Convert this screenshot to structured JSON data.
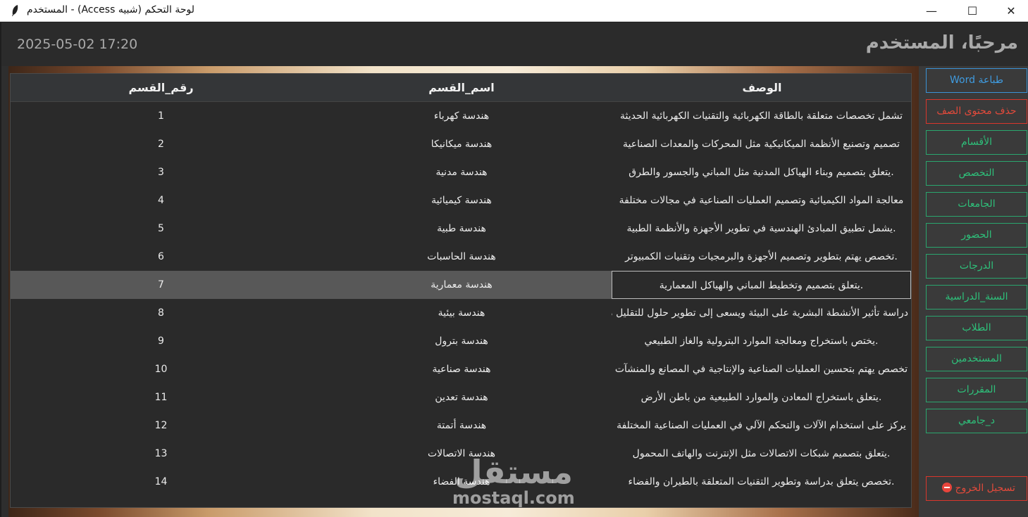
{
  "window": {
    "title": "المستخدم - (Access شبيه) لوحة التحكم",
    "min_icon": "—",
    "max_icon": "☐",
    "close_icon": "✕"
  },
  "header": {
    "welcome": "مرحبًا، المستخدم",
    "datetime": "2025-05-02 17:20"
  },
  "table": {
    "columns": {
      "description": "الوصف",
      "name": "اسم_القسم",
      "number": "رقم_القسم"
    },
    "rows": [
      {
        "number": "1",
        "name": "هندسة كهرباء",
        "description": "تشمل تخصصات متعلقة بالطاقة الكهربائية والتقنيات الكهربائية الحديثة"
      },
      {
        "number": "2",
        "name": "هندسة ميكانيكا",
        "description": "تصميم وتصنيع الأنظمة الميكانيكية مثل المحركات والمعدات الصناعية"
      },
      {
        "number": "3",
        "name": "هندسة مدنية",
        "description": ".يتعلق بتصميم وبناء الهياكل المدنية مثل المباني والجسور والطرق"
      },
      {
        "number": "4",
        "name": "هندسة كيميائية",
        "description": "معالجة المواد الكيميائية وتصميم العمليات الصناعية في مجالات مختلفة"
      },
      {
        "number": "5",
        "name": "هندسة طبية",
        "description": ".يشمل تطبيق المبادئ الهندسية في تطوير الأجهزة والأنظمة الطبية"
      },
      {
        "number": "6",
        "name": "هندسة الحاسبات",
        "description": ".تخصص يهتم بتطوير وتصميم الأجهزة والبرمجيات وتقنيات الكمبيوتر"
      },
      {
        "number": "7",
        "name": "هندسة معمارية",
        "description": ".يتعلق بتصميم وتخطيط المباني والهياكل المعمارية",
        "selected": true
      },
      {
        "number": "8",
        "name": "هندسة بيئية",
        "description": "دراسة تأثير الأنشطة البشرية على البيئة ويسعى إلى تطوير حلول للتقليل من هذا التأثير"
      },
      {
        "number": "9",
        "name": "هندسة بترول",
        "description": ".يختص باستخراج ومعالجة الموارد البترولية والغاز الطبيعي"
      },
      {
        "number": "10",
        "name": "هندسة صناعية",
        "description": "تخصص يهتم بتحسين العمليات الصناعية والإنتاجية في المصانع والمنشآت"
      },
      {
        "number": "11",
        "name": "هندسة تعدين",
        "description": ".يتعلق باستخراج المعادن والموارد الطبيعية من باطن الأرض"
      },
      {
        "number": "12",
        "name": "هندسة أتمتة",
        "description": "يركز على استخدام الآلات والتحكم الآلي في العمليات الصناعية المختلفة"
      },
      {
        "number": "13",
        "name": "هندسة الاتصالات",
        "description": ".يتعلق بتصميم شبكات الاتصالات مثل الإنترنت والهاتف المحمول"
      },
      {
        "number": "14",
        "name": "هندسة الفضاء",
        "description": ".تخصص يتعلق بدراسة وتطوير التقنيات المتعلقة بالطيران والفضاء"
      }
    ]
  },
  "watermark": {
    "arabic": "مستقل",
    "latin": "mostaql.com"
  },
  "sidebar": {
    "word_print": "طباعة Word",
    "delete_row": "حذف محتوى الصف",
    "items": [
      "الأقسام",
      "التخصص",
      "الجامعات",
      "الحضور",
      "الدرجات",
      "السنة_الدراسية",
      "الطلاب",
      "المستخدمين",
      "المقررات",
      "د_جامعي"
    ],
    "logout": "تسجيل الخروج"
  },
  "colors": {
    "accent_green": "#2ec07a",
    "accent_blue": "#3f9bdf",
    "accent_red": "#e24a3b",
    "panel": "#303030",
    "selected_row": "#585858"
  }
}
